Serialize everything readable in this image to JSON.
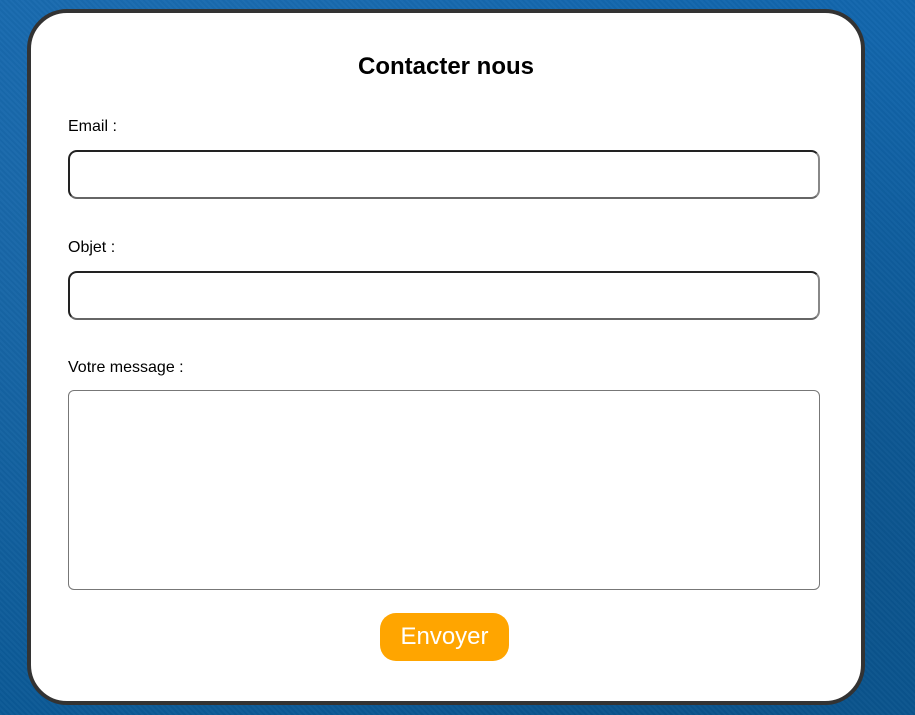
{
  "form": {
    "title": "Contacter nous",
    "email": {
      "label": "Email :",
      "value": "",
      "placeholder": ""
    },
    "subject": {
      "label": "Objet :",
      "value": "",
      "placeholder": ""
    },
    "message": {
      "label": "Votre message :",
      "value": "",
      "placeholder": ""
    },
    "submit_label": "Envoyer"
  },
  "colors": {
    "page_background": "#0d5fa3",
    "card_background": "#ffffff",
    "card_border": "#333333",
    "submit_button": "#ffa500",
    "submit_text": "#ffffff"
  }
}
